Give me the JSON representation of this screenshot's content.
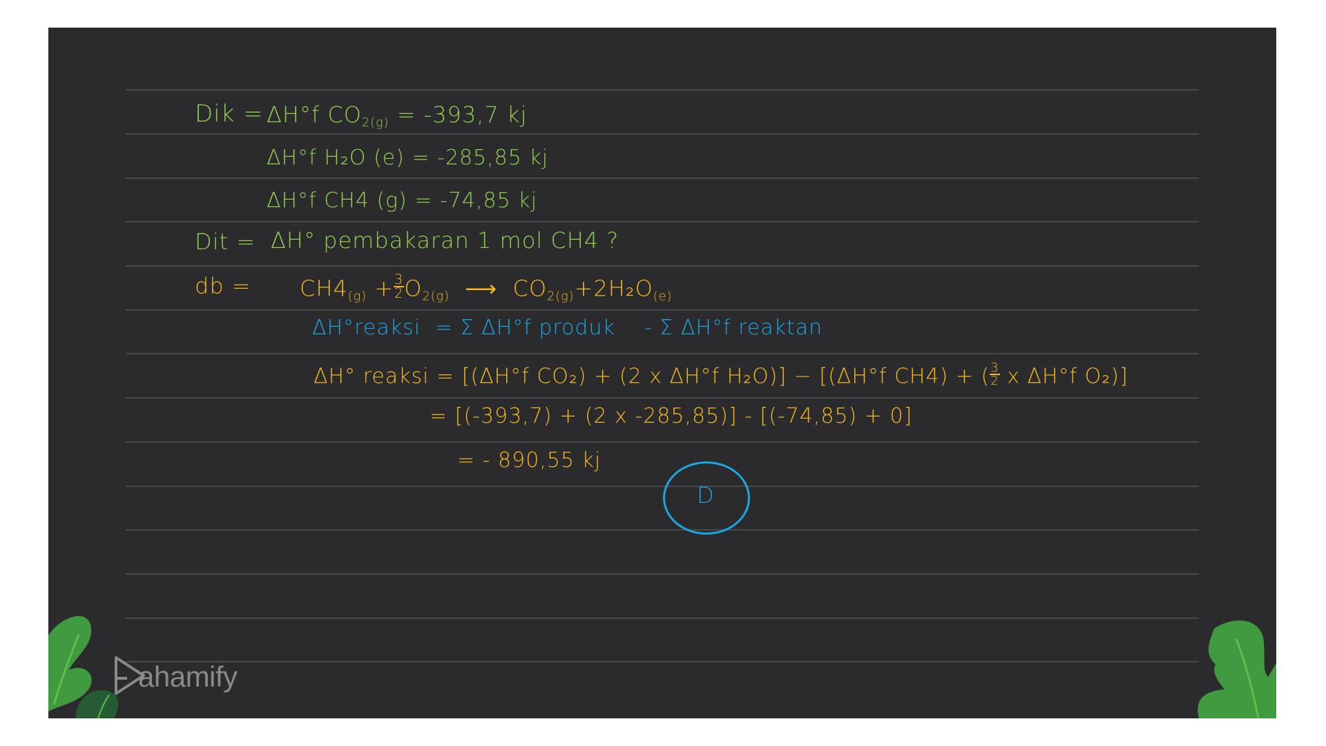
{
  "known": {
    "label": "Dik =",
    "items": [
      {
        "symbol": "ΔH°f",
        "species": "CO",
        "sub": "2",
        "phase": "(g)",
        "eq": "=",
        "value": "-393,7 kj"
      },
      {
        "symbol": "ΔH°f",
        "species": "H₂O",
        "sub": "",
        "phase": "(e)",
        "eq": "=",
        "value": "-285,85 kj"
      },
      {
        "symbol": "ΔH°f",
        "species": "CH4",
        "sub": "",
        "phase": "(g)",
        "eq": "=",
        "value": "-74,85 kj"
      }
    ]
  },
  "question": {
    "label": "Dit =",
    "text": "ΔH° pembakaran 1 mol CH4 ?"
  },
  "answer_section": {
    "label": "db =",
    "reaction": {
      "reactant1": "CH4",
      "reactant1_phase": "(g)",
      "plus1": "+",
      "coef_num": "3",
      "coef_den": "2",
      "reactant2": "O",
      "reactant2_sub": "2",
      "reactant2_phase": "(g)",
      "arrow": "⟶",
      "product1": "CO",
      "product1_sub": "2",
      "product1_phase": "(g)",
      "plus2": "+",
      "product2": "2H₂O",
      "product2_phase": "(e)"
    },
    "formula": "ΔH°reaksi = Σ ΔH°f produk - Σ ΔH°f reaktan",
    "formula_lhs": "ΔH°reaksi",
    "formula_rhs": "= Σ ΔH°f  produk",
    "formula_rhs2": "- Σ ΔH°f reaktan",
    "step1_lhs": "ΔH° reaksi",
    "step1_rhs_a": "= [(ΔH°f CO₂) + (2 x ΔH°f H₂O)] − [(ΔH°f CH4) + (",
    "step1_frac_num": "3",
    "step1_frac_den": "2",
    "step1_rhs_b": " x ΔH°f O₂)]",
    "step2": "= [(-393,7) + (2 x -285,85)] - [(-74,85) + 0]",
    "result": "=  - 890,55  kj",
    "choice": "D"
  },
  "brand": {
    "name": "ahamify",
    "logo_icon": "play-triangle-p-icon"
  },
  "colors": {
    "board": "#2b2b2d",
    "green_ink": "#8fd14f",
    "yellow_ink": "#f5b820",
    "blue_ink": "#1aa7e3",
    "leaf_light": "#3f9a40",
    "leaf_dark": "#265b34"
  }
}
